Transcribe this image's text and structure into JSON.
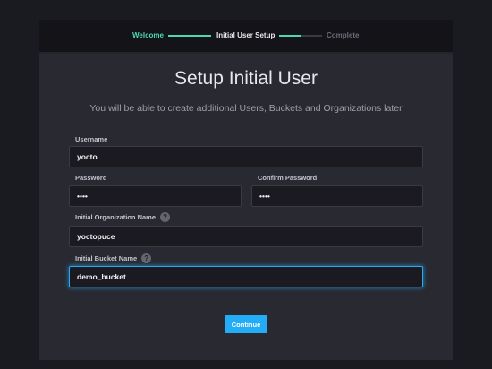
{
  "wizard": {
    "steps": [
      {
        "label": "Welcome",
        "state": "done"
      },
      {
        "label": "Initial User Setup",
        "state": "current"
      },
      {
        "label": "Complete",
        "state": "pending"
      }
    ]
  },
  "form": {
    "title": "Setup Initial User",
    "subtitle": "You will be able to create additional Users, Buckets and Organizations later",
    "username": {
      "label": "Username",
      "value": "yocto"
    },
    "password": {
      "label": "Password",
      "value": "••••"
    },
    "confirm_password": {
      "label": "Confirm Password",
      "value": "••••"
    },
    "organization": {
      "label": "Initial Organization Name",
      "value": "yoctopuce",
      "help_icon": "?"
    },
    "bucket": {
      "label": "Initial Bucket Name",
      "value": "demo_bucket",
      "help_icon": "?"
    },
    "continue_label": "Continue"
  },
  "colors": {
    "accent": "#22adf6",
    "step_done": "#4dd8b4",
    "background": "#1a1a21",
    "panel": "#292931"
  }
}
